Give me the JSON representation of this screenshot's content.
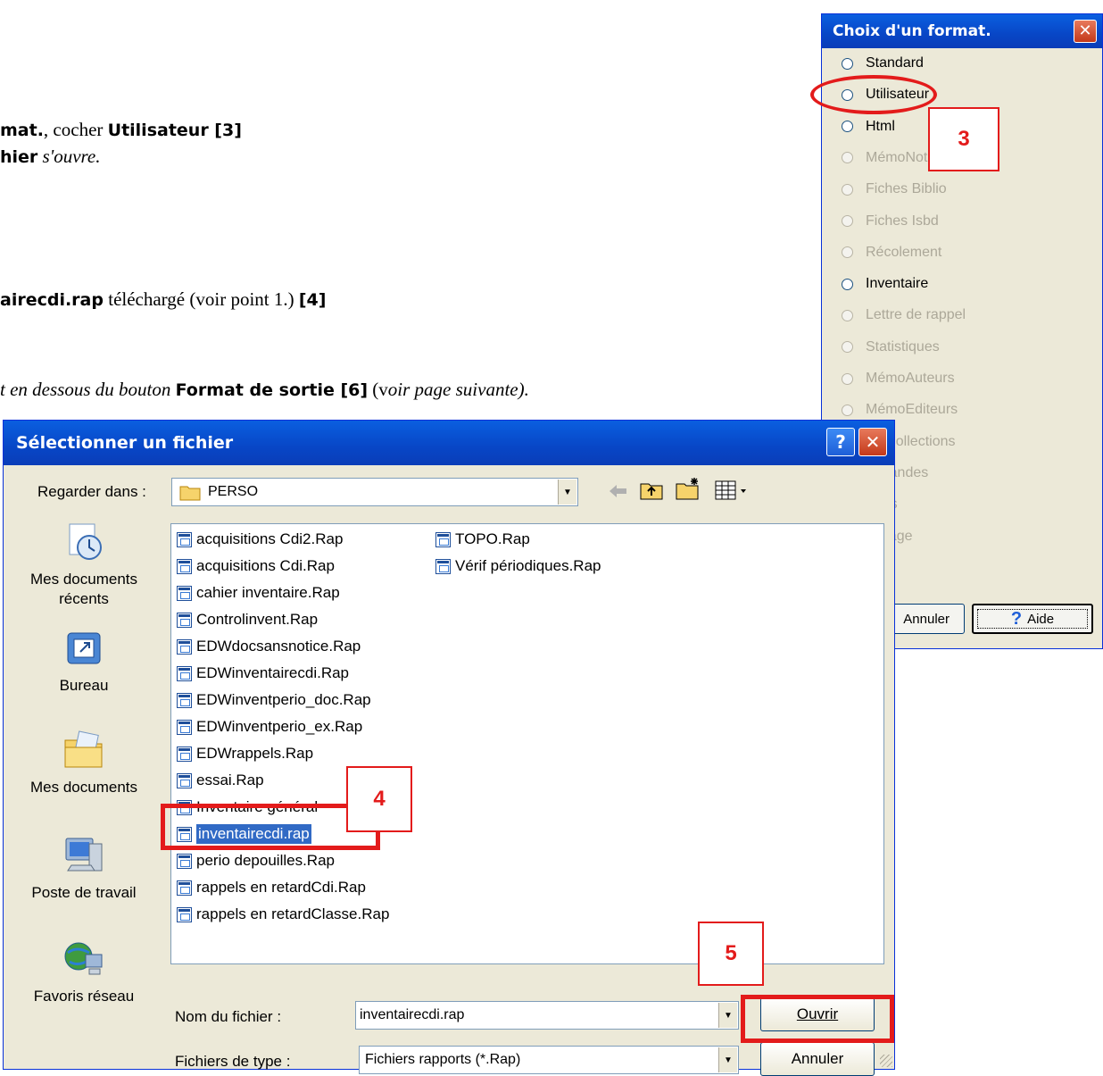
{
  "document": {
    "line1": {
      "b1": "mat.",
      "t1": ", cocher ",
      "b2": "Utilisateur [3]"
    },
    "line2": {
      "b1": "hier",
      "i1": " s'ouvre."
    },
    "line3": {
      "b1": "airecdi.rap",
      "t1": " téléchargé (voir point 1.) ",
      "b2": "[4]"
    },
    "line4": {
      "i1": "t en dessous du bouton ",
      "b1": "Format de sortie [6]",
      "t1": " (v",
      "i2": "oir page suivante)."
    }
  },
  "format_dialog": {
    "title": "Choix d'un format.",
    "close_glyph": "✕",
    "options": [
      {
        "label": "Standard",
        "enabled": true
      },
      {
        "label": "Utilisateur",
        "enabled": true
      },
      {
        "label": "Html",
        "enabled": true
      },
      {
        "label": "MémoNot",
        "enabled": false
      },
      {
        "label": "Fiches Biblio",
        "enabled": false
      },
      {
        "label": "Fiches Isbd",
        "enabled": false
      },
      {
        "label": "Récolement",
        "enabled": false
      },
      {
        "label": "Inventaire",
        "enabled": true
      },
      {
        "label": "Lettre de rappel",
        "enabled": false
      },
      {
        "label": "Statistiques",
        "enabled": false
      },
      {
        "label": "MémoAuteurs",
        "enabled": false
      },
      {
        "label": "MémoEditeurs",
        "enabled": false
      },
      {
        "label": "moCollections",
        "enabled": false
      },
      {
        "label": "mmandes",
        "enabled": false
      },
      {
        "label": "tures",
        "enabled": false
      },
      {
        "label": "etinage",
        "enabled": false
      }
    ],
    "cancel_label": "Annuler",
    "help_label": "Aide",
    "help_glyph": "?"
  },
  "file_dialog": {
    "title": "Sélectionner un fichier",
    "help_glyph": "?",
    "close_glyph": "✕",
    "look_in_label": "Regarder dans :",
    "look_in_value": "PERSO",
    "places": [
      {
        "label": "Mes documents\nrécents",
        "icon": "recent-documents-icon"
      },
      {
        "label": "Bureau",
        "icon": "desktop-icon"
      },
      {
        "label": "Mes documents",
        "icon": "my-documents-icon"
      },
      {
        "label": "Poste de travail",
        "icon": "my-computer-icon"
      },
      {
        "label": "Favoris réseau",
        "icon": "network-places-icon"
      }
    ],
    "files_col1": [
      "acquisitions Cdi2.Rap",
      "acquisitions Cdi.Rap",
      "cahier inventaire.Rap",
      "Controlinvent.Rap",
      "EDWdocsansnotice.Rap",
      "EDWinventairecdi.Rap",
      "EDWinventperio_doc.Rap",
      "EDWinventperio_ex.Rap",
      "EDWrappels.Rap",
      "essai.Rap",
      "Inventaire général",
      "inventairecdi.rap",
      "perio depouilles.Rap",
      "rappels en retardCdi.Rap",
      "rappels en retardClasse.Rap"
    ],
    "files_col2": [
      "TOPO.Rap",
      "Vérif périodiques.Rap"
    ],
    "selected_file": "inventairecdi.rap",
    "filename_label": "Nom du fichier :",
    "filename_value": "inventairecdi.rap",
    "filetype_label": "Fichiers de type :",
    "filetype_value": "Fichiers rapports (*.Rap)",
    "open_label": "Ouvrir",
    "cancel_label": "Annuler"
  },
  "callouts": {
    "c3": "3",
    "c4": "4",
    "c5": "5"
  },
  "colors": {
    "callout": "#e31b1b",
    "xp_blue": "#0a5fe0",
    "selection": "#316ac5",
    "dialog_bg": "#ece9d8"
  }
}
